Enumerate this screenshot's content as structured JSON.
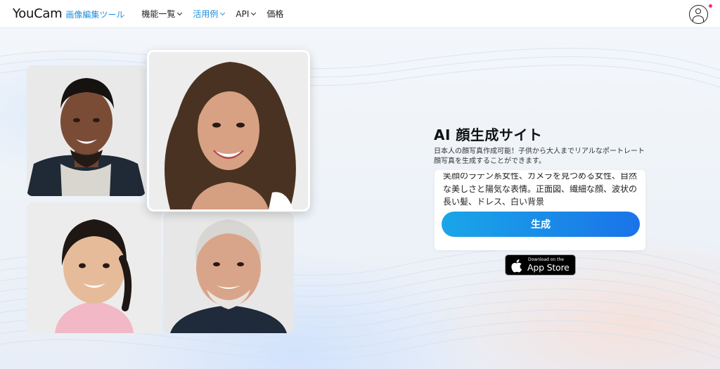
{
  "header": {
    "logo_main": "YouCam",
    "logo_sub": "画像編集ツール",
    "nav": [
      {
        "label": "機能一覧"
      },
      {
        "label": "活用例"
      },
      {
        "label": "API"
      },
      {
        "label": "価格"
      }
    ]
  },
  "hero": {
    "title": "AI 顔生成サイト",
    "description": "日本人の顔写真作成可能！子供から大人までリアルなポートレート顔写真を生成することができます。",
    "prompt_text": "笑顔のラテン系女性、カメラを見つめる女性、自然な美しさと陽気な表情。正面図、繊細な顔、波状の長い髪、ドレス、白い背景",
    "generate_label": "生成",
    "appstore_small": "Download on the",
    "appstore_big": "App Store"
  },
  "colors": {
    "accent": "#1f8fe0",
    "button_start": "#1aa6e8",
    "button_end": "#1a73e8",
    "notification": "#ff2d6f"
  },
  "icons": [
    "chevron-down-icon",
    "account-icon",
    "apple-icon"
  ]
}
